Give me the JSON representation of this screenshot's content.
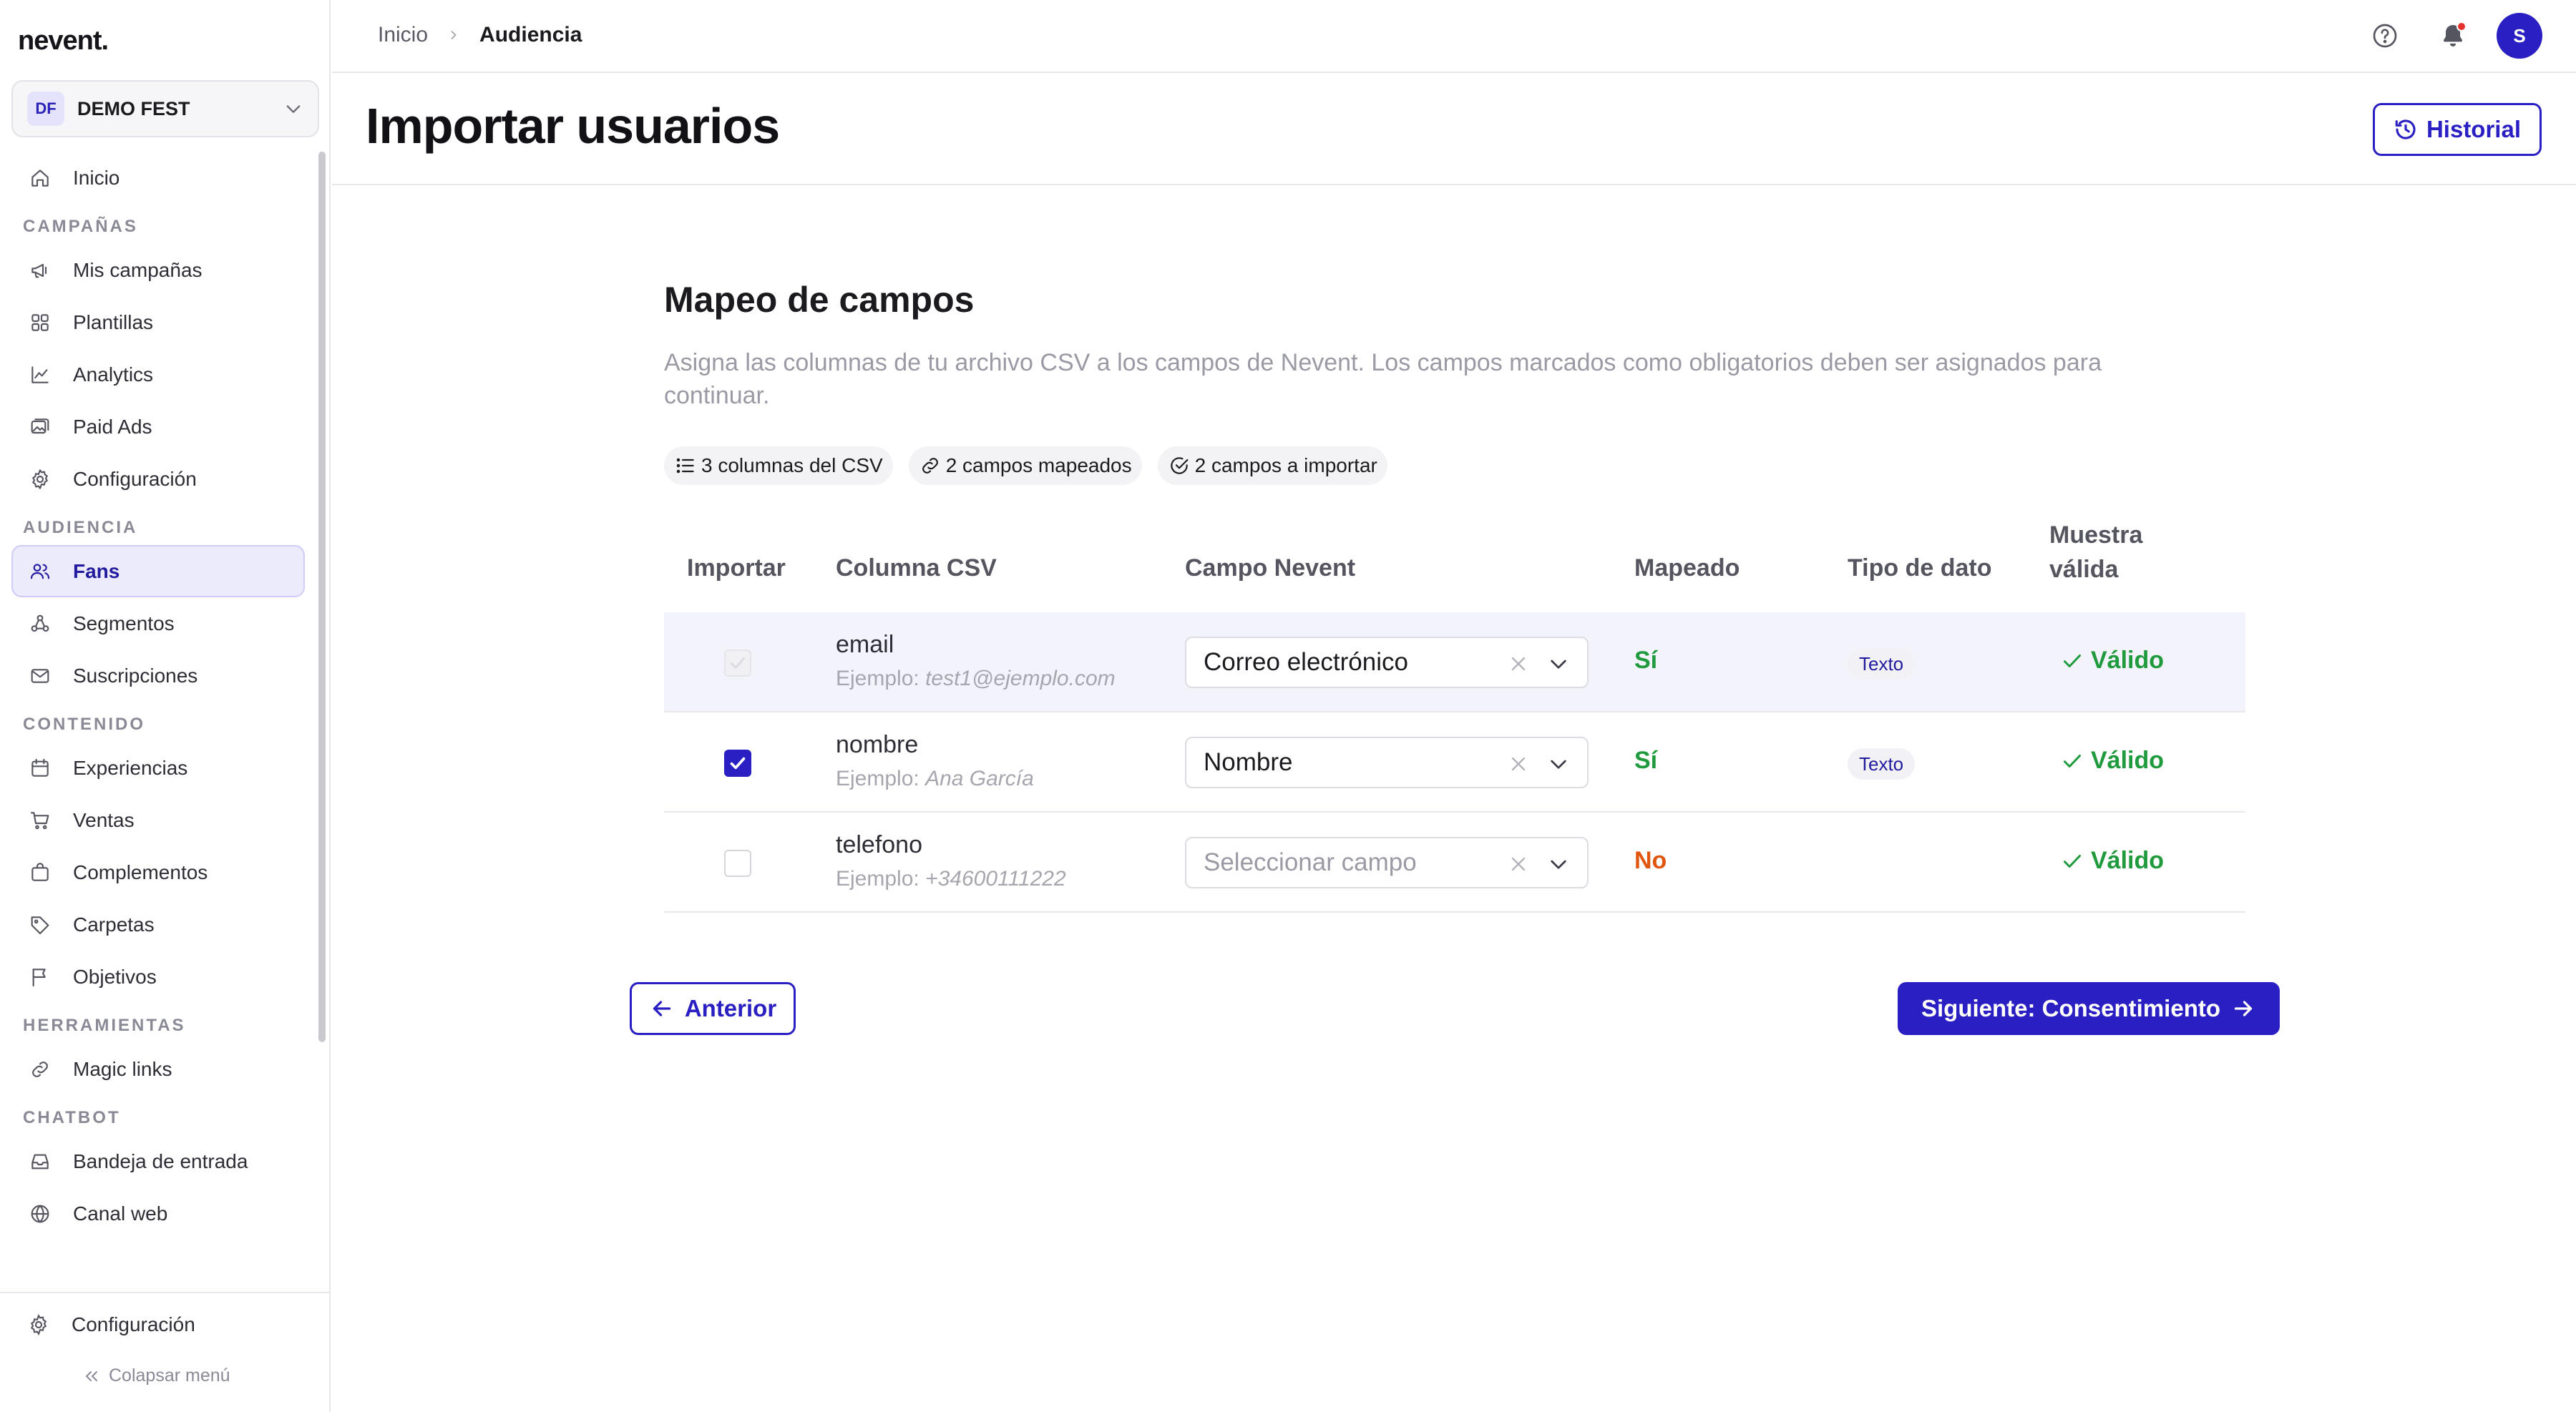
{
  "app": {
    "logo": "nevent."
  },
  "org": {
    "initials": "DF",
    "name": "DEMO FEST"
  },
  "sidebar": {
    "sections": [
      {
        "items": [
          {
            "label": "Inicio",
            "icon": "home-icon"
          }
        ]
      },
      {
        "title": "CAMPAÑAS",
        "items": [
          {
            "label": "Mis campañas",
            "icon": "megaphone-icon"
          },
          {
            "label": "Plantillas",
            "icon": "grid-icon"
          },
          {
            "label": "Analytics",
            "icon": "chart-line-icon"
          },
          {
            "label": "Paid Ads",
            "icon": "image-ads-icon"
          },
          {
            "label": "Configuración",
            "icon": "gear-icon"
          }
        ]
      },
      {
        "title": "AUDIENCIA",
        "items": [
          {
            "label": "Fans",
            "icon": "users-icon",
            "active": true
          },
          {
            "label": "Segmentos",
            "icon": "segments-icon"
          },
          {
            "label": "Suscripciones",
            "icon": "mail-icon"
          }
        ]
      },
      {
        "title": "CONTENIDO",
        "items": [
          {
            "label": "Experiencias",
            "icon": "calendar-icon"
          },
          {
            "label": "Ventas",
            "icon": "cart-icon"
          },
          {
            "label": "Complementos",
            "icon": "bag-icon"
          },
          {
            "label": "Carpetas",
            "icon": "tag-icon"
          },
          {
            "label": "Objetivos",
            "icon": "flag-icon"
          }
        ]
      },
      {
        "title": "HERRAMIENTAS",
        "items": [
          {
            "label": "Magic links",
            "icon": "link-icon"
          }
        ]
      },
      {
        "title": "CHATBOT",
        "items": [
          {
            "label": "Bandeja de entrada",
            "icon": "inbox-icon"
          },
          {
            "label": "Canal web",
            "icon": "globe-icon"
          }
        ]
      }
    ],
    "bottom_config": "Configuración",
    "collapse": "Colapsar menú"
  },
  "breadcrumb": {
    "home": "Inicio",
    "current": "Audiencia"
  },
  "avatar": {
    "initial": "S"
  },
  "header": {
    "title": "Importar usuarios",
    "history_button": "Historial"
  },
  "mapping": {
    "title": "Mapeo de campos",
    "description": "Asigna las columnas de tu archivo CSV a los campos de Nevent. Los campos marcados como obligatorios deben ser asignados para continuar.",
    "chips": [
      {
        "label": "3 columnas del CSV",
        "icon": "list-icon"
      },
      {
        "label": "2 campos mapeados",
        "icon": "link-icon"
      },
      {
        "label": "2 campos a importar",
        "icon": "check-circle-icon"
      }
    ],
    "columns": {
      "import": "Importar",
      "csv": "Columna CSV",
      "field": "Campo Nevent",
      "mapped": "Mapeado",
      "type": "Tipo de dato",
      "valid_line1": "Muestra",
      "valid_line2": "válida"
    },
    "example_prefix": "Ejemplo:",
    "rows": [
      {
        "checked": true,
        "disabled": true,
        "name": "email",
        "example": "test1@ejemplo.com",
        "field": "Correo electrónico",
        "mapped": "Sí",
        "mapped_state": "yes",
        "type": "Texto",
        "valid": "Válido"
      },
      {
        "checked": true,
        "disabled": false,
        "name": "nombre",
        "example": "Ana García",
        "field": "Nombre",
        "mapped": "Sí",
        "mapped_state": "yes",
        "type": "Texto",
        "valid": "Válido"
      },
      {
        "checked": false,
        "disabled": false,
        "name": "telefono",
        "example": "+34600111222",
        "field": "",
        "placeholder": "Seleccionar campo",
        "mapped": "No",
        "mapped_state": "no",
        "type": "",
        "valid": "Válido"
      }
    ]
  },
  "actions": {
    "prev": "Anterior",
    "next": "Siguiente: Consentimiento"
  },
  "colors": {
    "accent": "#2a1fc2",
    "success": "#1f9a3d",
    "warning": "#e0560f",
    "active_bg": "#ecebfc"
  }
}
